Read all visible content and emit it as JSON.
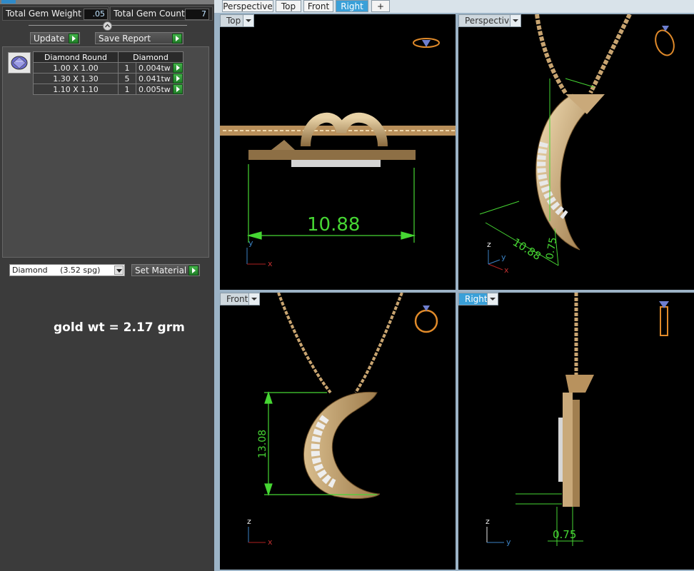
{
  "left_panel": {
    "total_gem_weight_label": "Total Gem Weight",
    "total_gem_weight_value": ".05",
    "total_gem_count_label": "Total Gem Count",
    "total_gem_count_value": "7",
    "update_label": "Update",
    "save_report_label": "Save Report",
    "table": {
      "headers": [
        "Diamond Round",
        "Diamond"
      ],
      "rows": [
        {
          "size": "1.00 X 1.00",
          "count": "1",
          "weight": "0.004tw"
        },
        {
          "size": "1.30 X 1.30",
          "count": "5",
          "weight": "0.041tw"
        },
        {
          "size": "1.10 X 1.10",
          "count": "1",
          "weight": "0.005tw"
        }
      ]
    },
    "material_select_value": "Diamond     (3.52 spg)",
    "set_material_label": "Set Material",
    "gold_weight_note": "gold wt = 2.17 grm"
  },
  "tabs": [
    "Perspective",
    "Top",
    "Front",
    "Right",
    "+"
  ],
  "active_tab": "Right",
  "viewports": {
    "top": {
      "label": "Top",
      "dimension": "10.88",
      "axis_labels": [
        "y",
        "x"
      ]
    },
    "perspective": {
      "label": "Perspective",
      "dimension_a": "10.88",
      "dimension_b": "0.75",
      "axis_labels": [
        "z",
        "y",
        "x"
      ]
    },
    "front": {
      "label": "Front",
      "dimension": "13.08",
      "axis_labels": [
        "z",
        "x"
      ]
    },
    "right": {
      "label": "Right",
      "dimension": "0.75",
      "axis_labels": [
        "z",
        "y"
      ]
    }
  },
  "colors": {
    "gold": "#c9a97a",
    "dimension_green": "#46d633",
    "viewport_bg": "#000000",
    "active_tab": "#3aa0d8"
  }
}
